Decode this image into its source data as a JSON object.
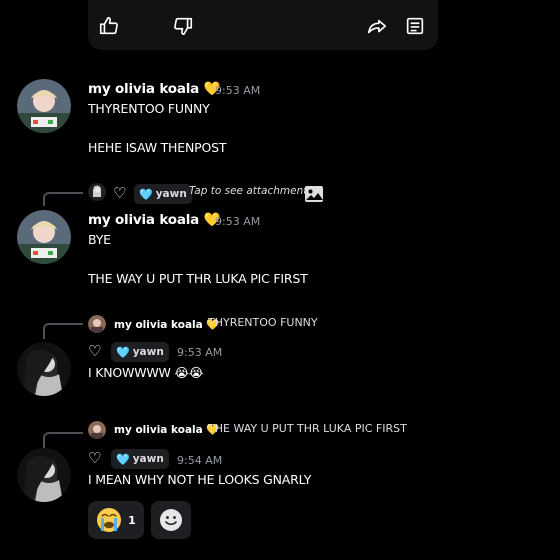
{
  "embed": {
    "like_icon": "thumbs-up-icon",
    "dislike_icon": "thumbs-down-icon",
    "share_icon": "share-arrow-icon",
    "save_icon": "note-icon"
  },
  "messages": [
    {
      "author": "my olivia koala",
      "badge": "💛",
      "time": "9:53 AM",
      "lines": [
        "THYRENTOO FUNNY",
        "HEHE ISAW THENPOST"
      ]
    },
    {
      "reply": {
        "tag": "yawn",
        "preview": "Tap to see attachment",
        "attachment_icon": "image-icon"
      },
      "author": "my olivia koala",
      "badge": "💛",
      "time": "9:53 AM",
      "lines": [
        "BYE",
        "THE WAY U PUT THR LUKA PIC FIRST"
      ]
    },
    {
      "reply": {
        "author": "my olivia koala",
        "badge": "💛",
        "text": "THYRENTOO FUNNY"
      },
      "tag": "yawn",
      "time": "9:53 AM",
      "lines": [
        "I KNOWWWW 😭😭"
      ]
    },
    {
      "reply": {
        "author": "my olivia koala",
        "badge": "💛",
        "text": "THE WAY U PUT THR LUKA PIC FIRST"
      },
      "tag": "yawn",
      "time": "9:54 AM",
      "lines": [
        "I MEAN WHY NOT HE LOOKS GNARLY"
      ]
    }
  ],
  "reactions": [
    {
      "emoji": "😭",
      "count": "1"
    },
    {
      "emoji": "add-reaction-icon",
      "count": ""
    }
  ],
  "colors": {
    "background": "#000000",
    "card": "#111214",
    "pill": "#1e1f22",
    "timestamp": "#949ba4",
    "badge": "#f5c518"
  }
}
